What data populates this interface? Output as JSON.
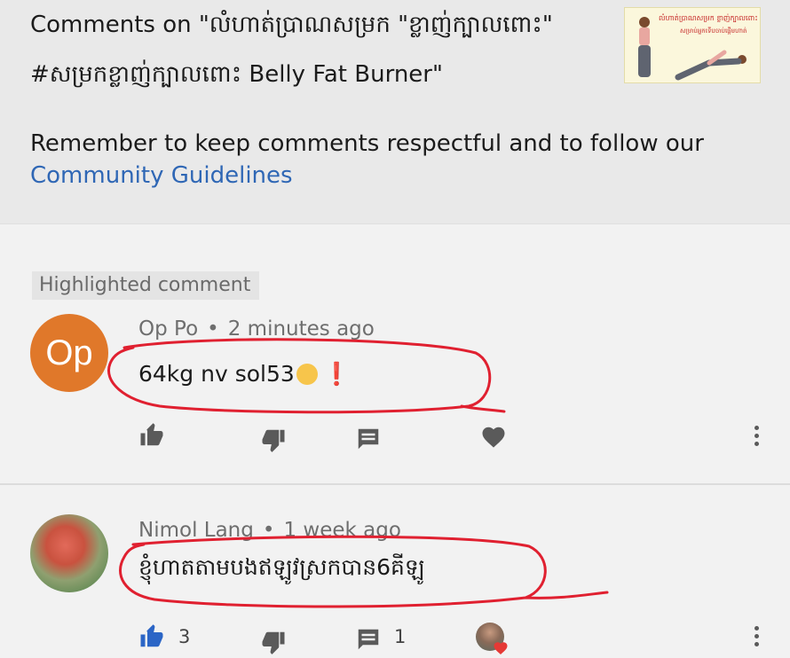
{
  "header": {
    "title": "Comments on \"លំហាត់ប្រាណសម្រក \"ខ្លាញ់ក្បាលពោះ\" #សម្រកខ្លាញ់ក្បាលពោះ Belly Fat Burner\"",
    "thumbnail": {
      "line1": "លំហាត់ប្រាណសម្រក ខ្លាញ់ក្បាលពោះ",
      "line2": "សម្រាប់អ្នកទើបចាប់ផ្តើមហាត់"
    }
  },
  "notice": {
    "text": "Remember to keep comments respectful and to follow our",
    "link": "Community Guidelines"
  },
  "highlight_label": "Highlighted comment",
  "comments": [
    {
      "avatar_text": "Op",
      "author": "Op Po",
      "time": "2 minutes ago",
      "text": "64kg nv sol53",
      "emoji": [
        "kissing-face",
        "red-exclamation"
      ],
      "likes": "",
      "replies": ""
    },
    {
      "avatar_text": "",
      "author": "Nimol Lang",
      "time": "1 week ago",
      "text": "ខ្ញុំហាតតាមបងឥឡូវស្រកបាន6គីឡូ",
      "likes": "3",
      "replies": "1"
    }
  ],
  "colors": {
    "accent_link": "#2f67b5",
    "liked_blue": "#2b65c6",
    "avatar_orange": "#e0782a",
    "annotation_red": "#e02030"
  },
  "icons": [
    "thumb-up-icon",
    "thumb-down-icon",
    "comment-icon",
    "heart-icon",
    "more-vert-icon"
  ]
}
